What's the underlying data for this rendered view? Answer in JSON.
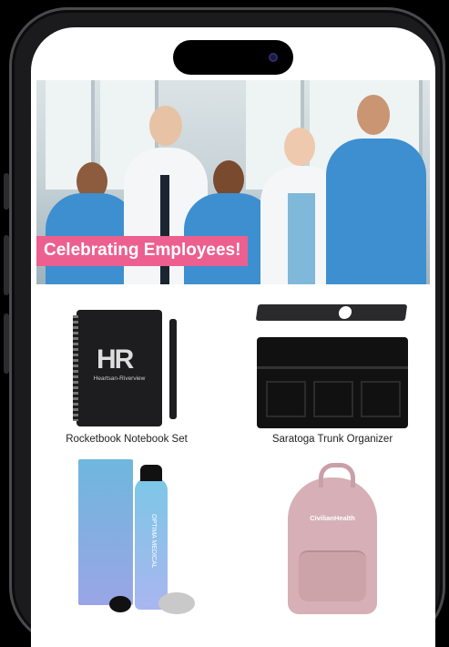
{
  "hero": {
    "banner_text": "Celebrating Employees!"
  },
  "products": [
    {
      "name": "Rocketbook Notebook Set",
      "brand_text": "HR",
      "brand_sub": "Heartsan-Riverview"
    },
    {
      "name": "Saratoga Trunk Organizer"
    },
    {
      "name": "",
      "brand_text": "OPTIMA MEDICAL"
    },
    {
      "name": "",
      "brand_text": "CivilianHealth"
    }
  ],
  "colors": {
    "accent": "#ec5f8f",
    "scrubs": "#3d8fd0",
    "frame": "#1b1b1d"
  }
}
